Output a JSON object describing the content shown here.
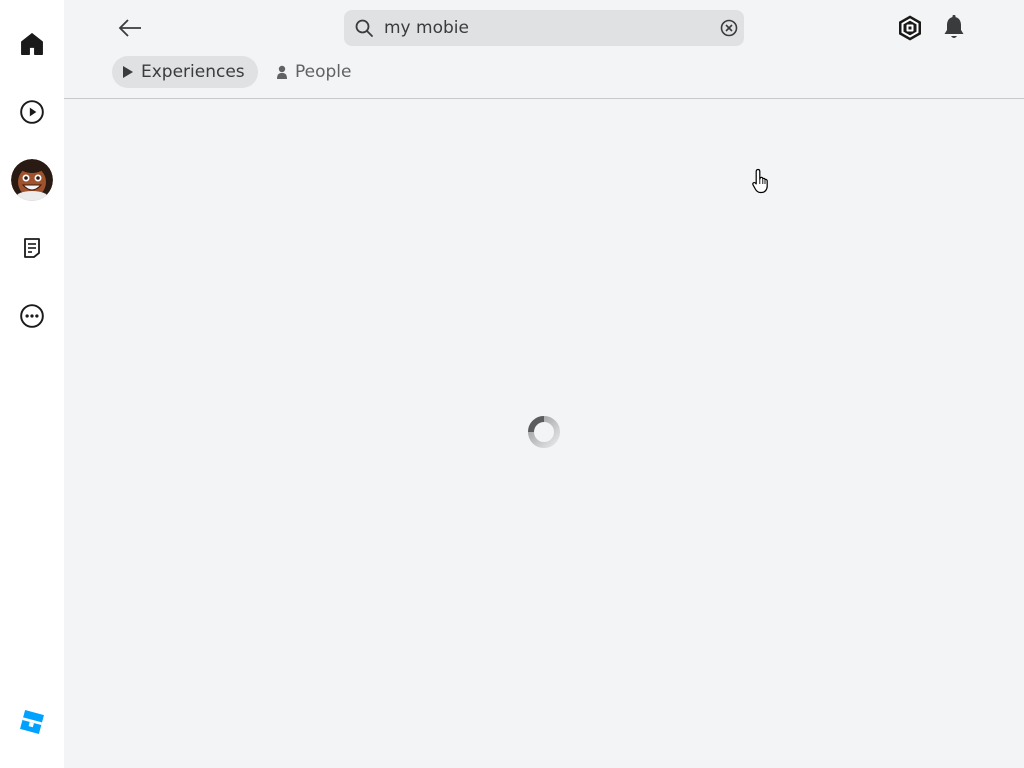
{
  "search": {
    "value": "my mobie",
    "icon": "search-icon",
    "clear_icon": "clear-icon"
  },
  "tabs": [
    {
      "label": "Experiences",
      "icon": "play-icon",
      "active": true
    },
    {
      "label": "People",
      "icon": "person-icon",
      "active": false
    }
  ],
  "sidebar": {
    "items": [
      {
        "name": "home",
        "icon": "home-icon"
      },
      {
        "name": "charts",
        "icon": "play-circle-icon"
      },
      {
        "name": "avatar",
        "icon": "avatar"
      },
      {
        "name": "messages",
        "icon": "notes-icon"
      },
      {
        "name": "more",
        "icon": "more-icon"
      }
    ],
    "logo": "roblox-logo"
  },
  "header": {
    "back_icon": "arrow-left-icon",
    "robux_icon": "robux-icon",
    "notifications_icon": "bell-icon"
  },
  "content": {
    "state": "loading"
  },
  "colors": {
    "background": "#f2f4f5",
    "sidebar": "#ffffff",
    "accent": "#00a2ff",
    "text": "#393b3d"
  }
}
